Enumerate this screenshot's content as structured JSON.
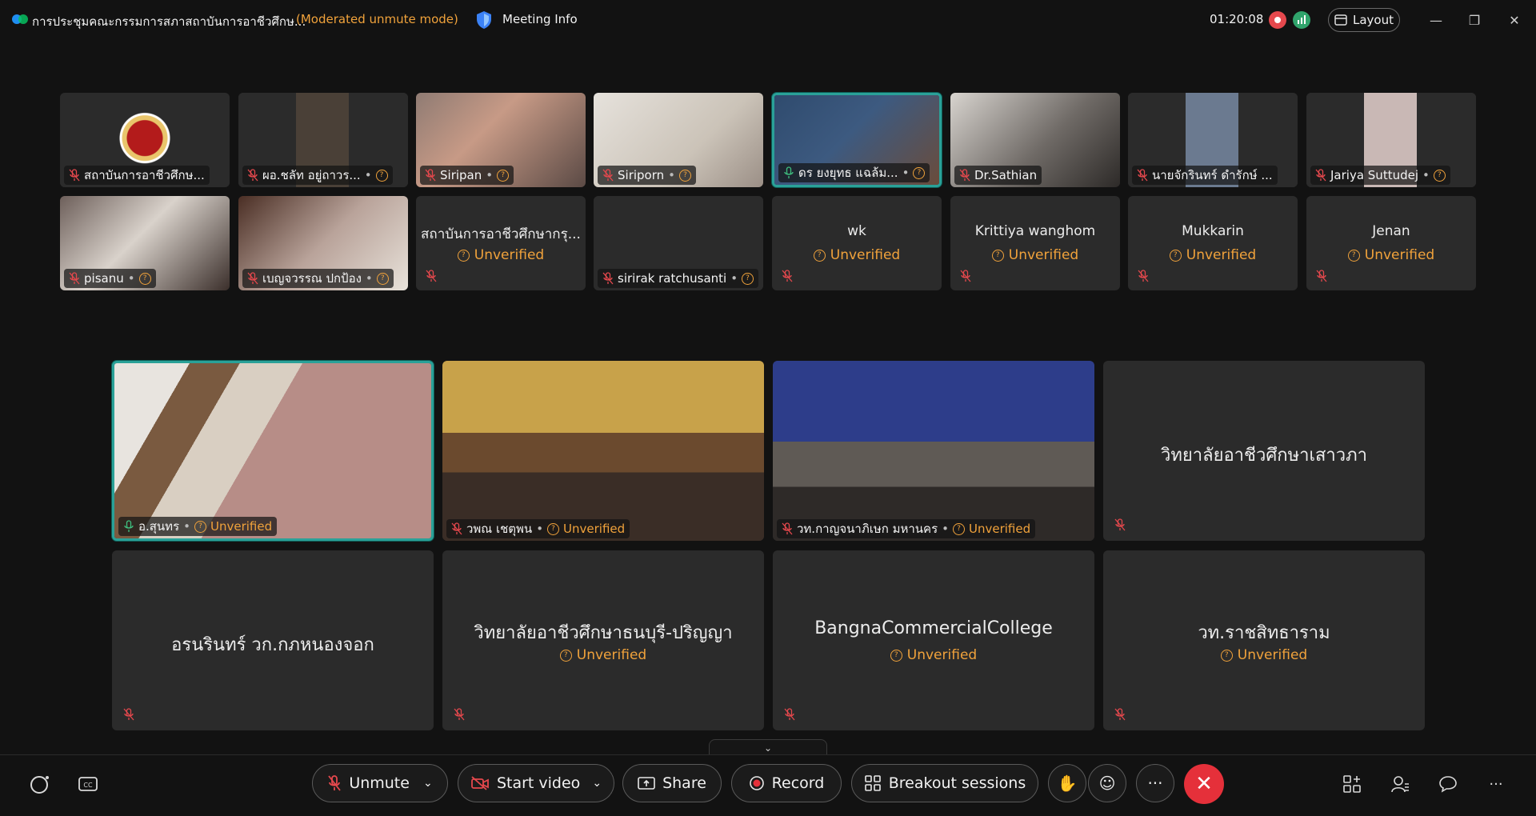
{
  "titlebar": {
    "meeting_title": "การประชุมคณะกรรมการสภาสถาบันการอาชีวศึกษ...",
    "mode": "(Moderated unmute mode)",
    "meeting_info": "Meeting Info",
    "timer": "01:20:08",
    "layout": "Layout"
  },
  "gallery_top": [
    {
      "name": "สถาบันการอาชีวศึกษ...",
      "unverified": false,
      "has_q": false
    },
    {
      "name": "ผอ.ชลัท อยู่ถาวร...",
      "unverified": false,
      "has_q": true
    },
    {
      "name": "Siripan",
      "unverified": false,
      "has_q": true
    },
    {
      "name": "Siriporn",
      "unverified": false,
      "has_q": true
    },
    {
      "name": "ดร ยงยุทธ แฉล้ม...",
      "unverified": false,
      "has_q": true
    },
    {
      "name": "Dr.Sathian",
      "unverified": false,
      "has_q": false
    },
    {
      "name": "นายจักรินทร์ ดำรักษ์ ...",
      "unverified": false,
      "has_q": false
    },
    {
      "name": "Jariya Suttudej",
      "unverified": false,
      "has_q": true
    },
    {
      "name": "pisanu",
      "unverified": false,
      "has_q": true
    },
    {
      "name": "เบญจวรรณ ปกป้อง",
      "unverified": false,
      "has_q": true
    },
    {
      "name": "สถาบันการอาชีวศึกษากรุ...",
      "unverified": true
    },
    {
      "name": "sirirak ratchusanti",
      "unverified": false,
      "has_q": true
    },
    {
      "name": "wk",
      "unverified": true
    },
    {
      "name": "Krittiya wanghom",
      "unverified": true
    },
    {
      "name": "Mukkarin",
      "unverified": true
    },
    {
      "name": "Jenan",
      "unverified": true
    }
  ],
  "gallery_main": [
    {
      "name": "อ.สุนทร",
      "status": "Unverified"
    },
    {
      "name": "วพณ เชตุพน",
      "status": "Unverified"
    },
    {
      "name": "วท.กาญจนาภิเษก มหานคร",
      "status": "Unverified"
    },
    {
      "name": "วิทยาลัยอาชีวศึกษาเสาวภา",
      "status": ""
    },
    {
      "name": "อรนรินทร์ วก.กภหนองจอก",
      "status": ""
    },
    {
      "name": "วิทยาลัยอาชีวศึกษาธนบุรี-ปริญญา",
      "status": "Unverified"
    },
    {
      "name": "BangnaCommercialCollege",
      "status": "Unverified"
    },
    {
      "name": "วท.ราชสิทธาราม",
      "status": "Unverified"
    }
  ],
  "unverified_label": "Unverified",
  "controls": {
    "unmute": "Unmute",
    "start_video": "Start video",
    "share": "Share",
    "record": "Record",
    "breakout": "Breakout sessions"
  },
  "colors": {
    "accent": "#2aa198",
    "warning": "#f0a23b",
    "end_call": "#e5303a"
  }
}
